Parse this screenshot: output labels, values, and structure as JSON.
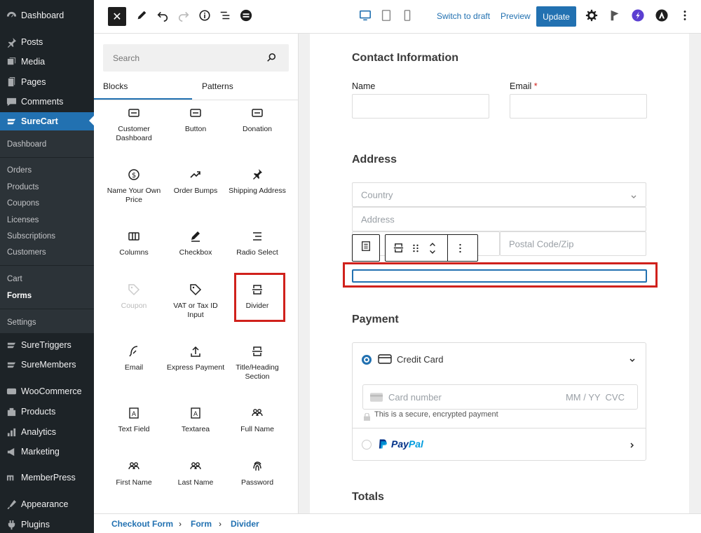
{
  "sidebar": {
    "items": [
      {
        "label": "Dashboard",
        "icon": "dashboard-icon"
      },
      {
        "label": "Posts",
        "icon": "pin-icon"
      },
      {
        "label": "Media",
        "icon": "media-icon"
      },
      {
        "label": "Pages",
        "icon": "pages-icon"
      },
      {
        "label": "Comments",
        "icon": "comments-icon"
      },
      {
        "label": "SureCart",
        "icon": "surecart-icon"
      }
    ],
    "surecart_sub": [
      "Dashboard",
      "Orders",
      "Products",
      "Coupons",
      "Licenses",
      "Subscriptions",
      "Customers",
      "Cart",
      "Forms",
      "Settings"
    ],
    "more_items": [
      {
        "label": "SureTriggers",
        "icon": "suretriggers-icon"
      },
      {
        "label": "SureMembers",
        "icon": "suremembers-icon"
      },
      {
        "label": "WooCommerce",
        "icon": "woocommerce-icon"
      },
      {
        "label": "Products",
        "icon": "products-icon"
      },
      {
        "label": "Analytics",
        "icon": "analytics-icon"
      },
      {
        "label": "Marketing",
        "icon": "marketing-icon"
      },
      {
        "label": "MemberPress",
        "icon": "memberpress-icon"
      },
      {
        "label": "Appearance",
        "icon": "appearance-icon"
      },
      {
        "label": "Plugins",
        "icon": "plugins-icon"
      }
    ]
  },
  "toolbar": {
    "close_label": "✕",
    "switch_to_draft": "Switch to draft",
    "preview": "Preview",
    "update": "Update"
  },
  "inserter": {
    "search_placeholder": "Search",
    "tabs": [
      "Blocks",
      "Patterns"
    ],
    "blocks": [
      {
        "label": "Customer Dashboard",
        "icon": "button-icon"
      },
      {
        "label": "Button",
        "icon": "button-icon"
      },
      {
        "label": "Donation",
        "icon": "button-icon"
      },
      {
        "label": "Name Your Own Price",
        "icon": "dollar-icon"
      },
      {
        "label": "Order Bumps",
        "icon": "trend-icon"
      },
      {
        "label": "Shipping Address",
        "icon": "pin-icon"
      },
      {
        "label": "Columns",
        "icon": "columns-icon"
      },
      {
        "label": "Checkbox",
        "icon": "pencil-icon"
      },
      {
        "label": "Radio Select",
        "icon": "list-icon"
      },
      {
        "label": "Coupon",
        "icon": "tag-icon"
      },
      {
        "label": "VAT or Tax ID Input",
        "icon": "tag-icon"
      },
      {
        "label": "Divider",
        "icon": "divider-icon"
      },
      {
        "label": "Email",
        "icon": "feather-icon"
      },
      {
        "label": "Express Payment",
        "icon": "upload-icon"
      },
      {
        "label": "Title/Heading Section",
        "icon": "divider-icon"
      },
      {
        "label": "Text Field",
        "icon": "textfield-icon"
      },
      {
        "label": "Textarea",
        "icon": "textfield-icon"
      },
      {
        "label": "Full Name",
        "icon": "users-icon"
      },
      {
        "label": "First Name",
        "icon": "users-icon"
      },
      {
        "label": "Last Name",
        "icon": "users-icon"
      },
      {
        "label": "Password",
        "icon": "fingerprint-icon"
      }
    ]
  },
  "form": {
    "contact_heading": "Contact Information",
    "name_label": "Name",
    "email_label": "Email",
    "required_mark": "*",
    "address_heading": "Address",
    "country_placeholder": "Country",
    "address_placeholder": "Address",
    "postal_placeholder": "Postal Code/Zip",
    "payment_heading": "Payment",
    "credit_card_label": "Credit Card",
    "card_number_placeholder": "Card number",
    "card_expiry_cvc": "MM / YY  CVC",
    "secure_note": "This is a secure, encrypted payment",
    "paypal_pay": "Pay",
    "paypal_pal": "Pal",
    "totals_heading": "Totals"
  },
  "breadcrumb": [
    "Checkout Form",
    "Form",
    "Divider"
  ],
  "breadcrumb_separator": "›",
  "colors": {
    "accent": "#2271b1",
    "highlight": "#d0211c",
    "sidebar": "#1d2327",
    "paypal_dark": "#003087",
    "paypal_light": "#009cde"
  }
}
